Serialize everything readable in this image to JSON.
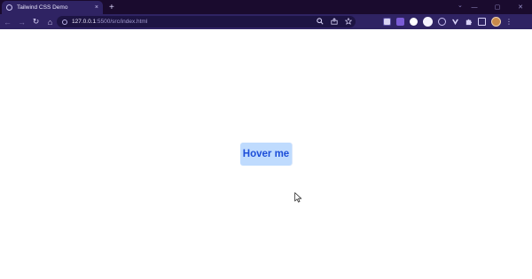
{
  "browser": {
    "tab": {
      "title": "Tailwind CSS Demo",
      "close_glyph": "×"
    },
    "new_tab_glyph": "+",
    "tab_search_glyph": "⌄",
    "window_controls": {
      "minimize": "—",
      "maximize": "▢",
      "close": "✕"
    },
    "toolbar": {
      "back_glyph": "←",
      "forward_glyph": "→",
      "reload_glyph": "↻",
      "home_glyph": "⌂"
    },
    "address_bar": {
      "host": "127.0.0.1",
      "path": ":5500/src/index.html",
      "icons": [
        "search-icon",
        "share-icon",
        "bookmark-star-icon"
      ]
    },
    "extensions": [
      "extension-icon",
      "extension-icon",
      "extension-icon",
      "extension-icon",
      "extension-icon",
      "extension-icon",
      "puzzle-icon",
      "side-panel-icon"
    ],
    "menu_glyph": "⋮"
  },
  "page": {
    "button_label": "Hover me",
    "button_colors": {
      "background": "#bfdbfe",
      "text": "#1d4ed8"
    }
  },
  "colors": {
    "tabbar_bg": "#1a0b2e",
    "toolbar_bg": "#2f2363",
    "omnibox_bg": "#1d1443",
    "page_bg": "#ffffff"
  }
}
